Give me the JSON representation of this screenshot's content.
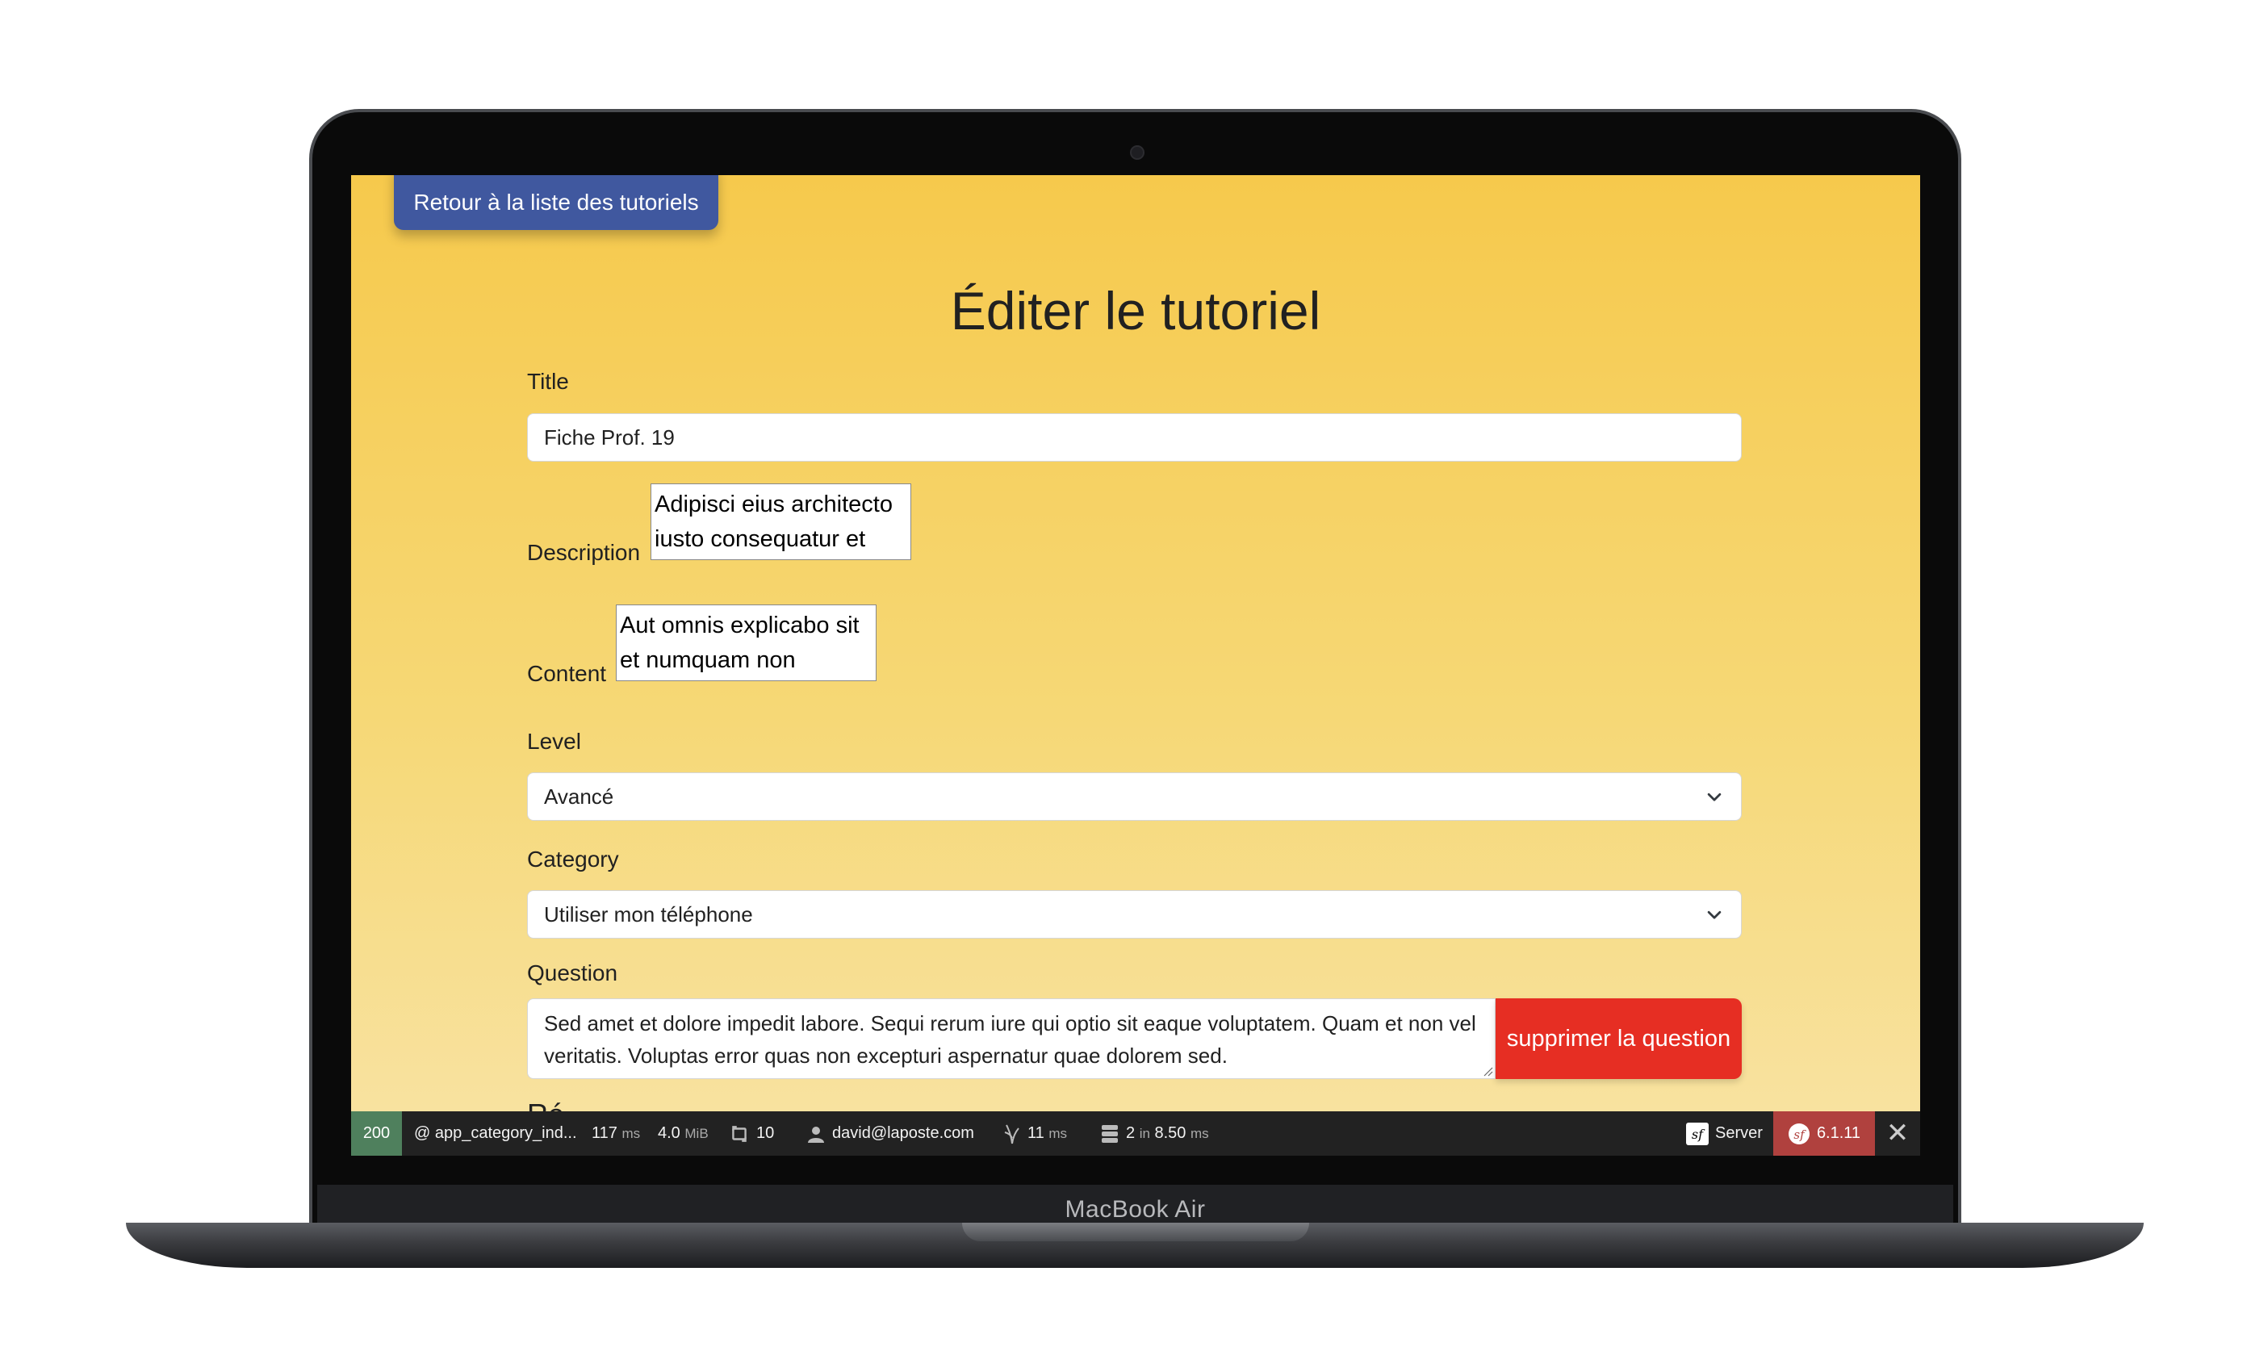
{
  "device": {
    "model_label": "MacBook Air"
  },
  "page": {
    "back_button": "Retour à la liste des tutoriels",
    "title": "Éditer le tutoriel"
  },
  "form": {
    "title_label": "Title",
    "title_value": "Fiche Prof. 19",
    "description_label": "Description",
    "description_value": "Adipisci eius architecto iusto consequatur et",
    "content_label": "Content",
    "content_value": "Aut omnis explicabo sit et numquam non",
    "level_label": "Level",
    "level_value": "Avancé",
    "category_label": "Category",
    "category_value": "Utiliser mon téléphone",
    "question_label": "Question",
    "question_value": "Sed amet et dolore impedit labore. Sequi rerum iure qui optio sit eaque voluptatem. Quam et non vel veritatis. Voluptas error quas non excepturi aspernatur quae dolorem sed.",
    "delete_question_button": "supprimer la question",
    "next_label_peek": "Ré"
  },
  "toolbar": {
    "status_code": "200",
    "route": "@ app_category_ind...",
    "time_value": "117",
    "time_unit": "ms",
    "memory_value": "4.0",
    "memory_unit": "MiB",
    "forms_count": "10",
    "user": "david@laposte.com",
    "twig_value": "11",
    "twig_unit": "ms",
    "db_count": "2",
    "db_in": "in",
    "db_time": "8.50",
    "db_unit": "ms",
    "server_label": "Server",
    "symfony_version": "6.1.11",
    "colors": {
      "status_ok": "#4f805d",
      "version_bg": "#b0413e"
    }
  },
  "colors": {
    "back_button": "#40589f",
    "delete_button": "#e62e23",
    "background_top": "#f6c94c",
    "background_bottom": "#f8e3a4"
  },
  "icons": [
    "chevron-down-icon",
    "sync-icon",
    "user-icon",
    "twig-icon",
    "database-icon",
    "symfony-icon",
    "close-icon"
  ]
}
